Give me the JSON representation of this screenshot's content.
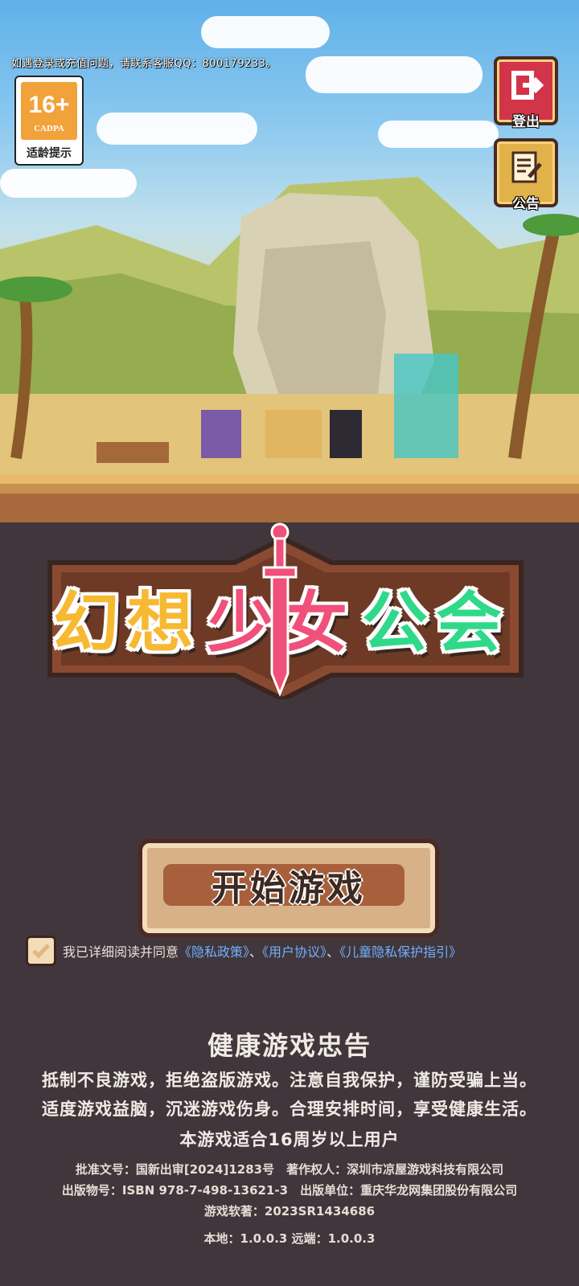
{
  "notice": "如遇登录或充值问题，请联系客服QQ：800179233。",
  "age_rating": {
    "number": "16+",
    "org": "CADPA",
    "label": "适龄提示"
  },
  "side_buttons": {
    "logout": "登出",
    "announcement": "公告"
  },
  "logo": {
    "chars": [
      "幻",
      "想",
      "少",
      "女",
      "公",
      "会"
    ]
  },
  "start_button": "开始游戏",
  "agreement": {
    "prefix": "我已详细阅读并同意",
    "privacy": "《隐私政策》",
    "sep1": "、",
    "user": "《用户协议》",
    "sep2": "、",
    "child": "《儿童隐私保护指引》"
  },
  "health": {
    "title": "健康游戏忠告",
    "line1": "抵制不良游戏，拒绝盗版游戏。注意自我保护，谨防受骗上当。",
    "line2": "适度游戏益脑，沉迷游戏伤身。合理安排时间，享受健康生活。",
    "line3": "本游戏适合16周岁以上用户"
  },
  "meta": {
    "line1": "批准文号：国新出审[2024]1283号　著作权人：深圳市凉屋游戏科技有限公司",
    "line2": "出版物号：ISBN 978-7-498-13621-3　出版单位：重庆华龙网集团股份有限公司",
    "line3": "游戏软著：2023SR1434686",
    "version": "本地：1.0.0.3  远端：1.0.0.3"
  },
  "colors": {
    "logo_yellow": "#f7b832",
    "logo_pink": "#f0507a",
    "logo_green": "#2fd98a",
    "link": "#6fb0ff"
  }
}
